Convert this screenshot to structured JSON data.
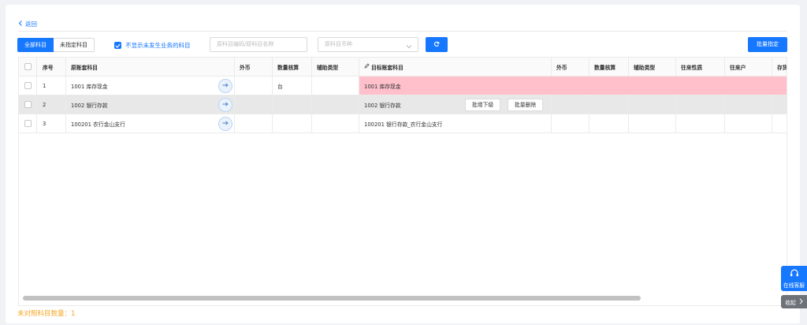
{
  "back": {
    "label": "返回"
  },
  "toolbar": {
    "tab_all": "全部科目",
    "tab_unassigned": "未指定科目",
    "hide_unused_label": "不显示未发生业务的科目",
    "search_placeholder": "原科目编码/原科目名称",
    "currency_placeholder": "原科目币种",
    "batch_assign_label": "批量指定"
  },
  "table": {
    "headers": {
      "seq": "序号",
      "source_account": "原账套科目",
      "fx": "外币",
      "qty": "数量核算",
      "aux": "辅助类型",
      "target_account": "目标账套科目",
      "fx2": "外币",
      "qty2": "数量核算",
      "aux2": "辅助类型",
      "nature": "往来性质",
      "party": "往来户",
      "stock": "存货"
    },
    "rows": [
      {
        "seq": "1",
        "source": "1001 库存现金",
        "qty": "台",
        "target": "1001 库存现金"
      },
      {
        "seq": "2",
        "source": "1002 银行存款",
        "qty": "",
        "target": "1002 银行存款"
      },
      {
        "seq": "3",
        "source": "100201 农行金山支行",
        "qty": "",
        "target": "100201 银行存款_农行金山支行"
      }
    ],
    "row_actions": {
      "batch_add_sub": "批增下级",
      "batch_delete": "批量删除"
    }
  },
  "footer": {
    "text": "未对照科目数量：1"
  },
  "side": {
    "online_service": "在线客服",
    "collapse": "收起"
  },
  "colors": {
    "accent": "#1677ff",
    "highlight_row": "#ffc0cb",
    "selected_row": "#e8e8e8",
    "warning_text": "#f5a623"
  }
}
